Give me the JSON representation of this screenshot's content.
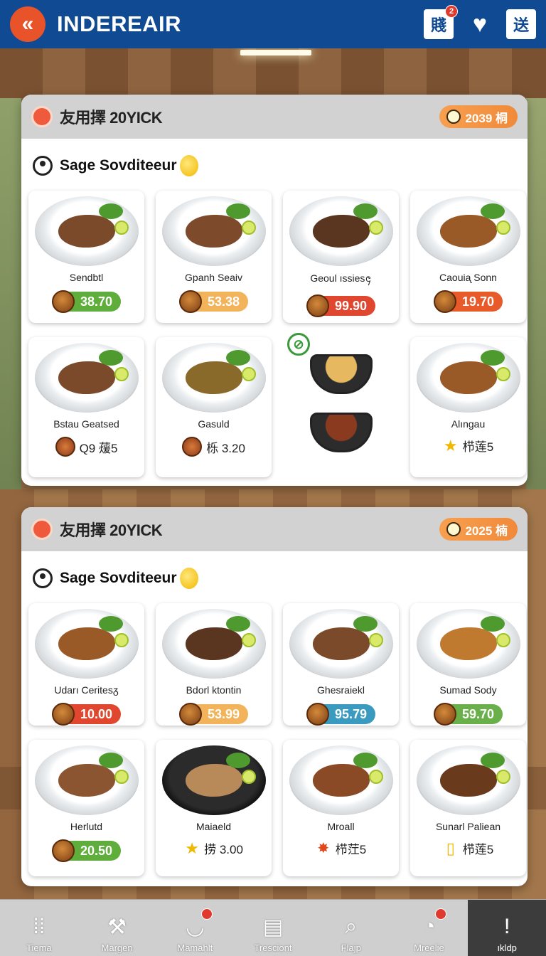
{
  "app": {
    "title": "INDEREAIR"
  },
  "topbar": {
    "back_icon": "double-chevron-left-icon",
    "icons": [
      {
        "name": "calendar-icon",
        "glyph": "賤",
        "badge": "2"
      },
      {
        "name": "heart-icon",
        "glyph": "♥",
        "badge": ""
      },
      {
        "name": "exit-icon",
        "glyph": "送",
        "badge": ""
      }
    ]
  },
  "panels": [
    {
      "title": "友用擇 20YICK",
      "pill": "2039 桐",
      "subtitle": "Sage Sovditeeur",
      "items": [
        {
          "name": "Sendbtl",
          "price": "38.70",
          "price_color": "#5fae3c",
          "style": "pill",
          "food_color": "#7a4a2a"
        },
        {
          "name": "Gpanh Seaiv",
          "price": "53.38",
          "price_color": "#f2b35a",
          "style": "pill",
          "food_color": "#7d4a2c"
        },
        {
          "name": "Geoul ıssies᪄",
          "price": "99.90",
          "price_color": "#e0472e",
          "style": "pill",
          "food_color": "#5a3520"
        },
        {
          "name": "Caouiᶏ Sonn",
          "price": "19.70",
          "price_color": "#e85a2a",
          "style": "pill",
          "food_color": "#9a5a28"
        },
        {
          "name": "Bstau Geatsed",
          "price": "Q9 蕿5",
          "price_color": "",
          "style": "plain",
          "food_color": "#7a4a2a"
        },
        {
          "name": "Gasuld",
          "price": "栎 3.20",
          "price_color": "",
          "style": "plain",
          "food_color": "#8a6a2a"
        },
        {
          "name": "",
          "price": "",
          "price_color": "",
          "style": "pots",
          "food_color": ""
        },
        {
          "name": "Alıngau",
          "price": "栉莲5",
          "price_color": "",
          "style": "plain-star",
          "food_color": "#9a5a28"
        }
      ]
    },
    {
      "title": "友用擇 20YICK",
      "pill": "2025 楠",
      "subtitle": "Sage Sovditeeur",
      "items": [
        {
          "name": "Udarı Ceritesᵹ",
          "price": "10.00",
          "price_color": "#e0472e",
          "style": "pill",
          "food_color": "#9a5a28"
        },
        {
          "name": "Bdorl ktontin",
          "price": "53.99",
          "price_color": "#f2b35a",
          "style": "pill",
          "food_color": "#5a3520"
        },
        {
          "name": "Ghesraiekl",
          "price": "95.79",
          "price_color": "#3a9ac0",
          "style": "pill",
          "food_color": "#7a4a2a"
        },
        {
          "name": "Sumad Sody",
          "price": "59.70",
          "price_color": "#6ab04a",
          "style": "pill",
          "food_color": "#c07a30"
        },
        {
          "name": "Herlutd",
          "price": "20.50",
          "price_color": "#5fae3c",
          "style": "pill",
          "food_color": "#8a5530"
        },
        {
          "name": "Maiaeld",
          "price": "捞 3.00",
          "price_color": "",
          "style": "plain-star",
          "food_color": "#b88a5a"
        },
        {
          "name": "Mroall",
          "price": "栉茳5",
          "price_color": "",
          "style": "plain-bolt",
          "food_color": "#8a4a26"
        },
        {
          "name": "Sunarl Paliean",
          "price": "栉莲5",
          "price_color": "",
          "style": "plain-tube",
          "food_color": "#6a3a1c"
        }
      ]
    }
  ],
  "bottomnav": [
    {
      "label": "Tiema",
      "icon": "grid-icon",
      "glyph": "⁞⁞",
      "badge": false,
      "active": false
    },
    {
      "label": "Margen",
      "icon": "tool-icon",
      "glyph": "⚒",
      "badge": false,
      "active": false
    },
    {
      "label": "Mamahlt",
      "icon": "bowl-icon",
      "glyph": "◡",
      "badge": true,
      "active": false
    },
    {
      "label": "Tresciont",
      "icon": "clipboard-icon",
      "glyph": "▤",
      "badge": false,
      "active": false
    },
    {
      "label": "Flajp",
      "icon": "search-icon",
      "glyph": "⌕",
      "badge": false,
      "active": false
    },
    {
      "label": "Mreelie",
      "icon": "chat-icon",
      "glyph": "◔",
      "badge": true,
      "active": false
    },
    {
      "label": "ıkldp",
      "icon": "alert-icon",
      "glyph": "!",
      "badge": false,
      "active": true
    }
  ]
}
